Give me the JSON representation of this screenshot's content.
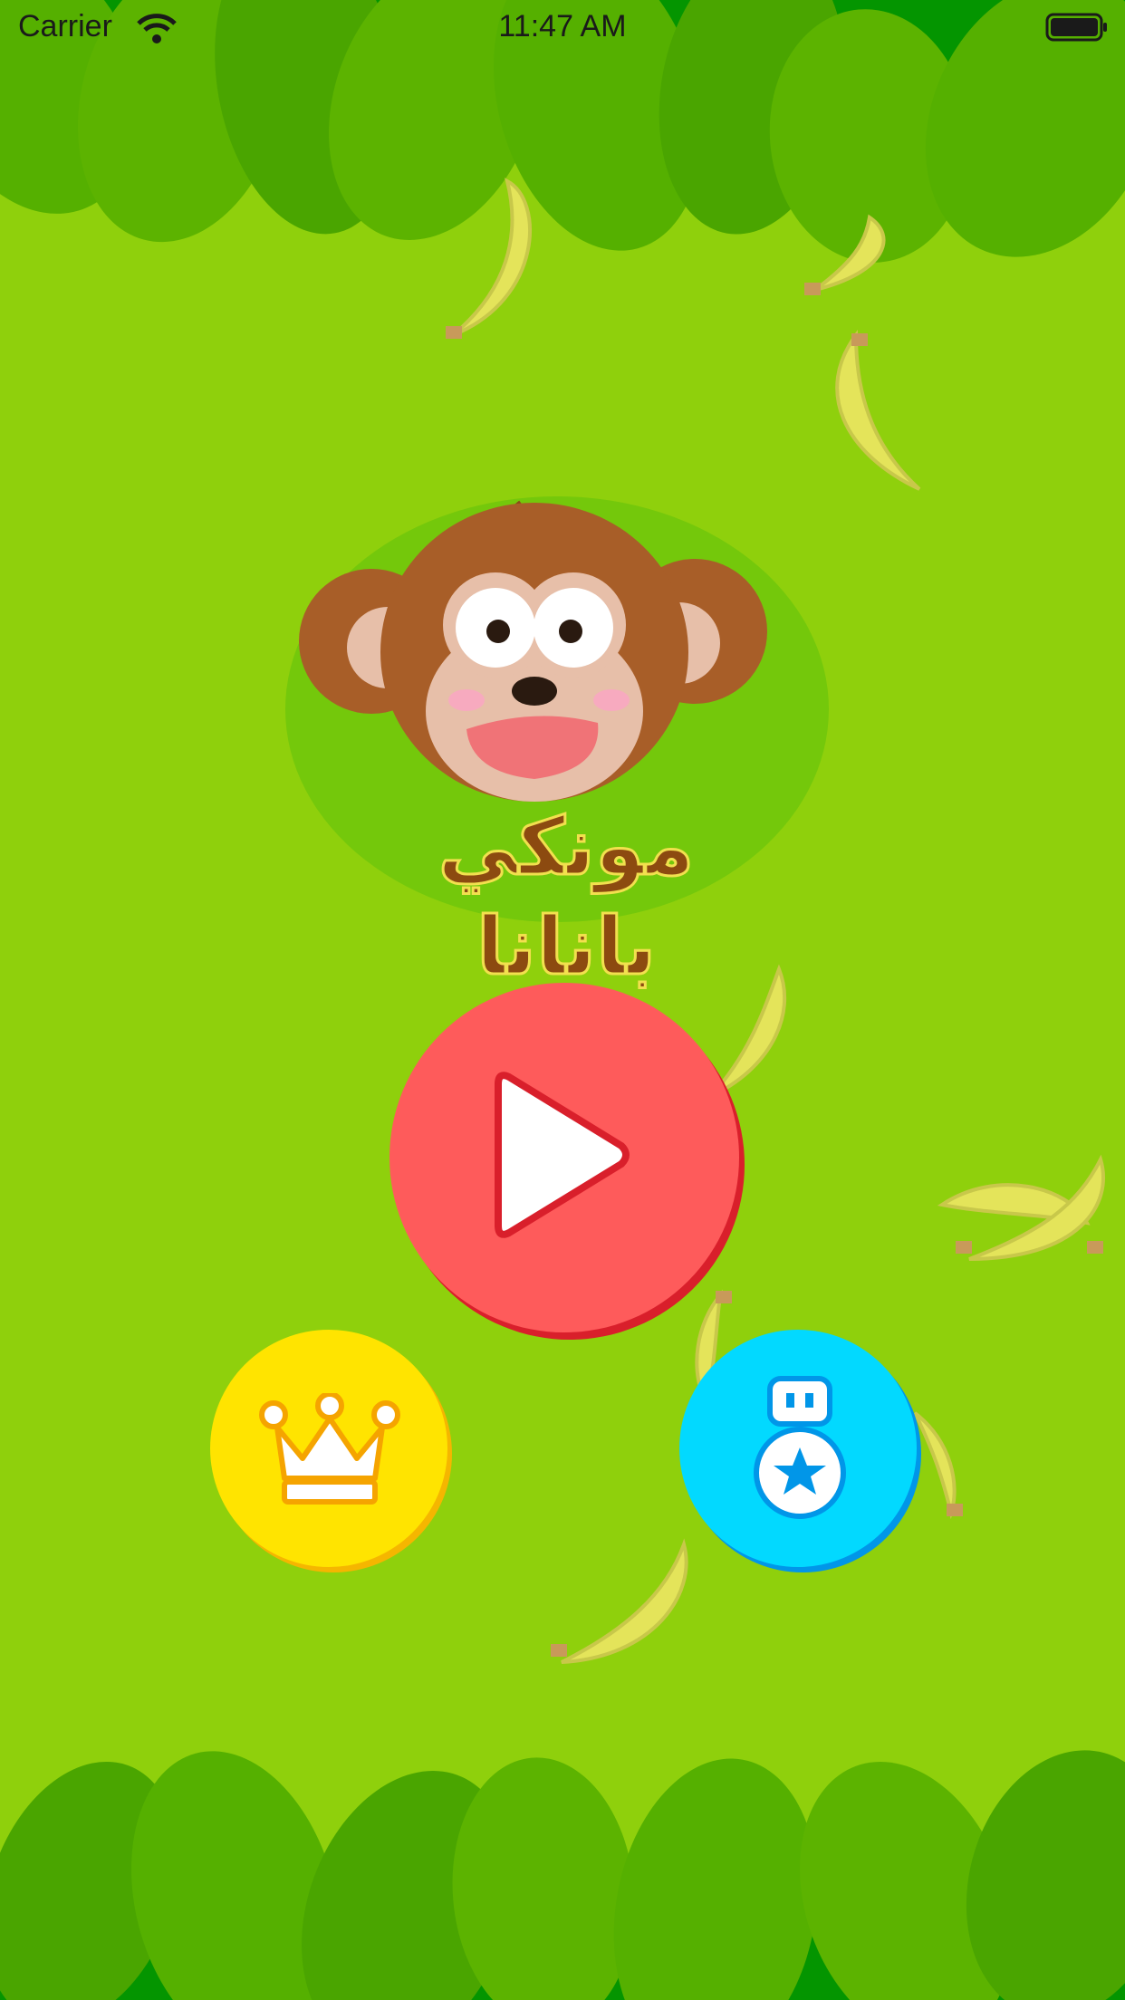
{
  "status_bar": {
    "carrier": "Carrier",
    "time": "11:47 AM"
  },
  "logo": {
    "title": "مونكي بانانا"
  },
  "buttons": {
    "play": "play-icon",
    "leaderboard": "crown-icon",
    "achievements": "medal-icon"
  },
  "colors": {
    "background": "#8fd00c",
    "play": "#fe5b5b",
    "leaderboard": "#ffe400",
    "achievements": "#02d9ff",
    "leaf_dark": "#049500",
    "leaf_light": "#5cb300"
  }
}
